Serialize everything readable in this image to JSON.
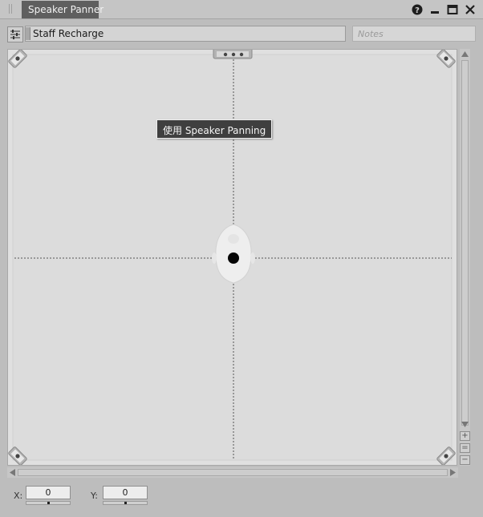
{
  "window": {
    "tab_title": "Speaker Panner",
    "icons": [
      "help-icon",
      "minimize-icon",
      "maximize-icon",
      "close-icon"
    ]
  },
  "toolbar": {
    "settings_icon": "sliders-icon",
    "preset_name": "Staff Recharge",
    "notes_placeholder": "Notes"
  },
  "panner": {
    "tooltip": "使用 Speaker Panning",
    "speakers": [
      "front-left",
      "front-center",
      "front-right",
      "rear-left",
      "rear-right"
    ],
    "listener": "head",
    "zoom_buttons": [
      "+",
      "=",
      "−"
    ]
  },
  "coords": {
    "x_label": "X:",
    "x_value": "0",
    "y_label": "Y:",
    "y_value": "0"
  },
  "colors": {
    "tab_bg": "#5f5f5f",
    "panel_bg": "#bdbdbd",
    "canvas_bg": "#e0e0e0",
    "tooltip_bg": "#3f3f3f"
  }
}
